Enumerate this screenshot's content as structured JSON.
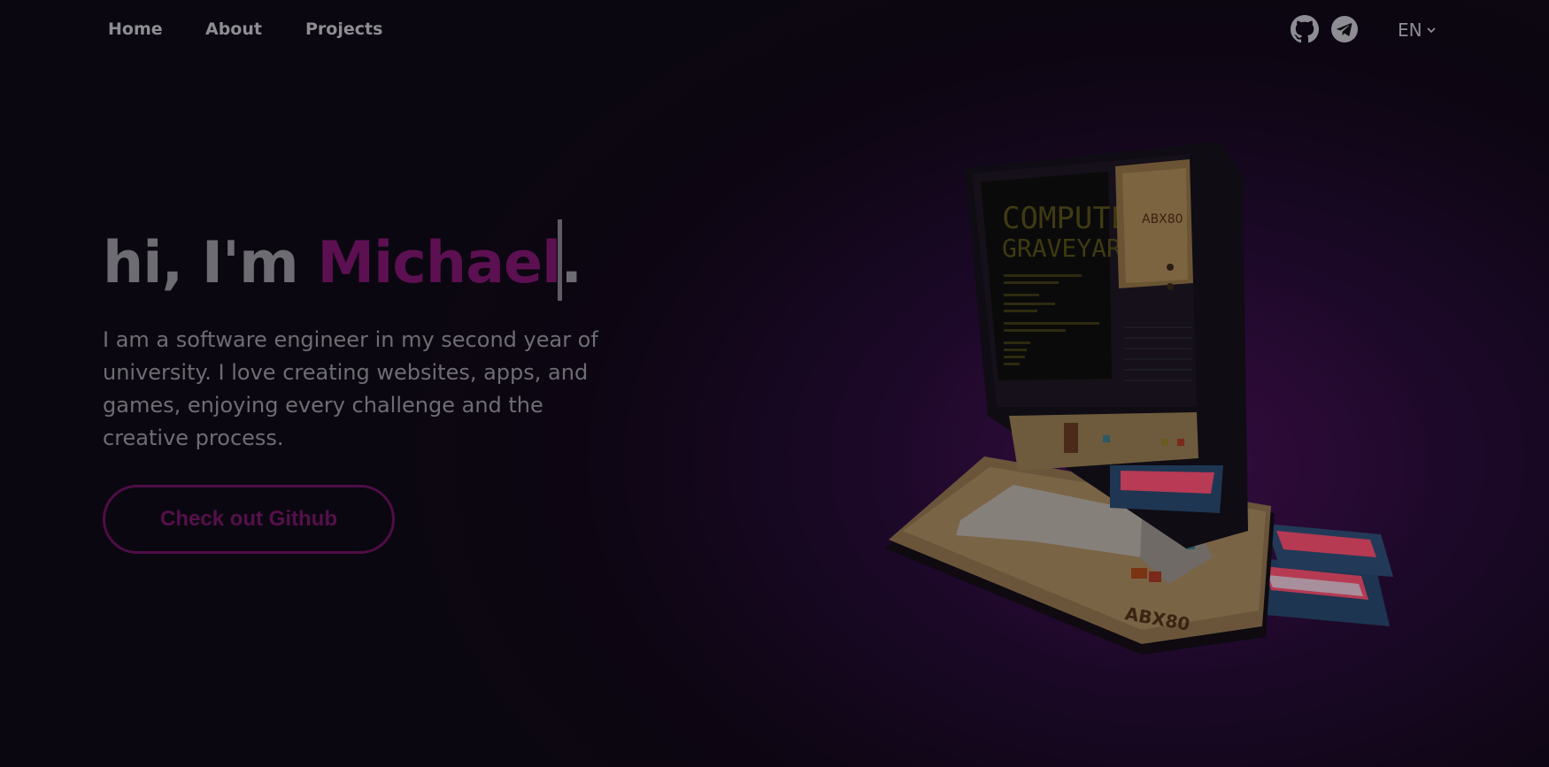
{
  "nav": {
    "links": [
      {
        "label": "Home"
      },
      {
        "label": "About"
      },
      {
        "label": "Projects"
      }
    ],
    "icons": [
      "github-icon",
      "telegram-icon"
    ],
    "language": "EN"
  },
  "hero": {
    "greeting": "hi, I'm ",
    "name": "Michael",
    "punctuation": ".",
    "description": "I am a software engineer in my second year of university. I love creating websites, apps, and games, enjoying every challenge and the creative process.",
    "cta_label": "Check out Github"
  },
  "illustration": {
    "screen_line1": "COMPUTER",
    "screen_line2": "GRAVEYARD",
    "brand_logo": "ABX80"
  },
  "colors": {
    "accent": "#5c1052",
    "text": "#6c6c72",
    "nav_text": "#8d8d93",
    "background": "#0b0710"
  }
}
